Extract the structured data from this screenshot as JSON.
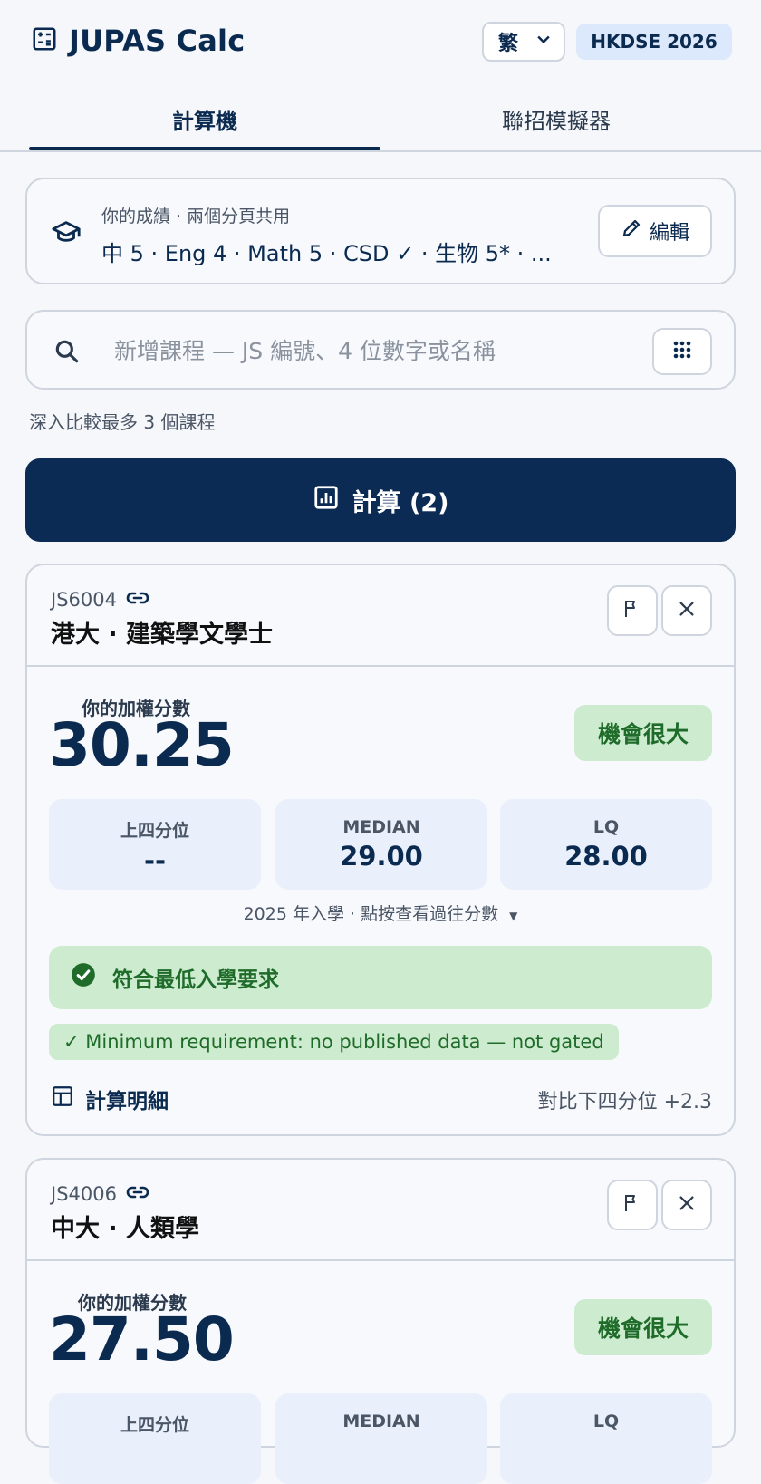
{
  "header": {
    "app_title": "JUPAS Calc",
    "lang_value": "繁",
    "year_badge": "HKDSE 2026"
  },
  "tabs": [
    {
      "label": "計算機",
      "active": true
    },
    {
      "label": "聯招模擬器",
      "active": false
    }
  ],
  "grades": {
    "label": "你的成績 · 兩個分頁共用",
    "summary": "中 5 · Eng 4 · Math 5 · CSD ✓ · 生物 5* · ...",
    "edit_label": "編輯"
  },
  "search": {
    "placeholder": "新增課程 — JS 編號、4 位數字或名稱"
  },
  "compare_note": "深入比較最多 3 個課程",
  "calc_button": "計算 (2)",
  "programs": [
    {
      "code": "JS6004",
      "name": "港大 · 建築學文學士",
      "ws_label": "你的加權分數",
      "score": "30.25",
      "chance": "機會很大",
      "uq_label": "上四分位",
      "uq_value": "--",
      "median_label": "MEDIAN",
      "median_value": "29.00",
      "lq_label": "LQ",
      "lq_value": "28.00",
      "year_note": "2025 年入學 · 點按查看過往分數",
      "meet": "符合最低入學要求",
      "min_note": "✓ Minimum requirement: no published data — not gated",
      "breakdown": "計算明細",
      "vs_lq": "對比下四分位 +2.3"
    },
    {
      "code": "JS4006",
      "name": "中大 · 人類學",
      "ws_label": "你的加權分數",
      "score": "27.50",
      "chance": "機會很大",
      "uq_label": "上四分位",
      "median_label": "MEDIAN",
      "lq_label": "LQ"
    }
  ],
  "colors": {
    "primary": "#0b2a54",
    "chance_bg": "#cdeccf",
    "chance_text": "#1f6b2a",
    "stat_bg": "#e9f0fb"
  }
}
